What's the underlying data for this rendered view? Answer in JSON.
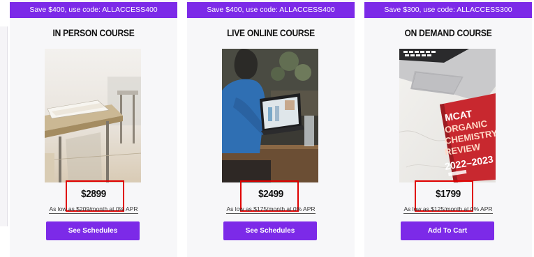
{
  "cards": [
    {
      "promo": "Save $400, use code: ALLACCESS400",
      "title": "IN PERSON COURSE",
      "price": "$2899",
      "financing": "As low as $209/month at 0% APR",
      "button": "See Schedules"
    },
    {
      "promo": "Save $400, use code: ALLACCESS400",
      "title": "LIVE ONLINE COURSE",
      "price": "$2499",
      "financing": "As low as $175/month at 0% APR",
      "button": "See Schedules"
    },
    {
      "promo": "Save $300, use code: ALLACCESS300",
      "title": "ON DEMAND COURSE",
      "price": "$1799",
      "financing": "As low as $125/month at 0% APR",
      "button": "Add To Cart"
    }
  ],
  "book_cover": {
    "line1": "MCAT",
    "line2": "ORGANIC",
    "line3": "CHEMISTRY",
    "line4": "REVIEW",
    "year": "2022–2023"
  },
  "colors": {
    "accent": "#7c2ae8",
    "highlight": "#e00000",
    "card_bg": "#f7f7f9"
  }
}
